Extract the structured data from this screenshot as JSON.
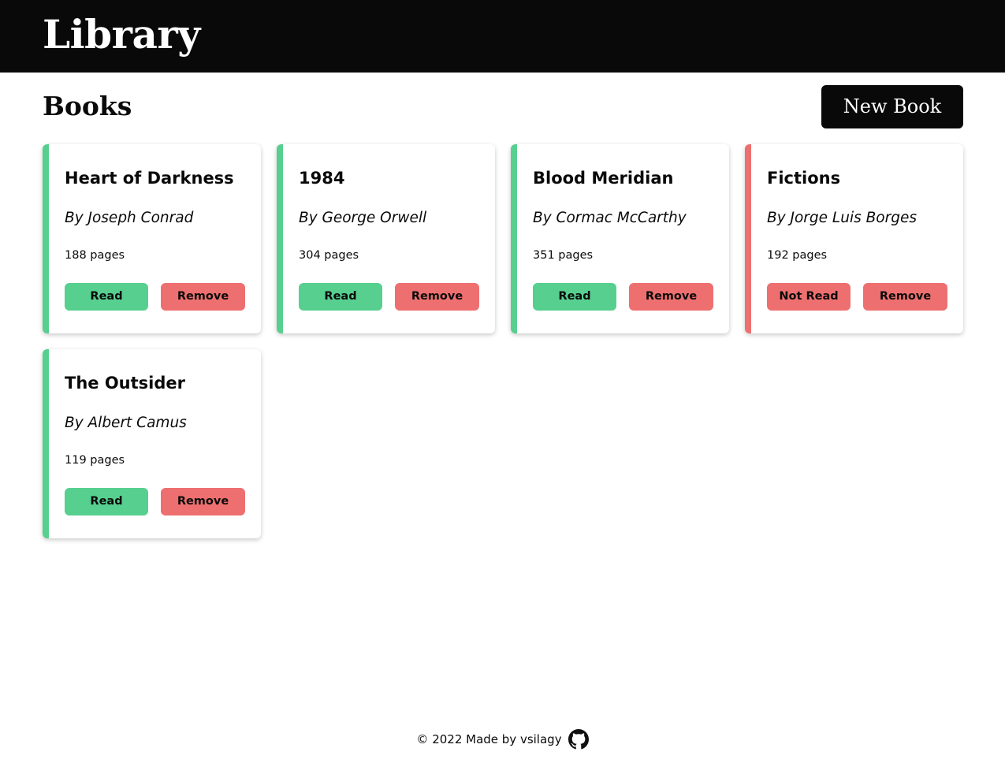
{
  "header": {
    "title": "Library"
  },
  "main": {
    "section_title": "Books",
    "new_book_label": "New Book"
  },
  "books": [
    {
      "title": "Heart of Darkness",
      "author": "By Joseph Conrad",
      "pages": "188 pages",
      "status_label": "Read",
      "read": true,
      "remove_label": "Remove"
    },
    {
      "title": "1984",
      "author": "By George Orwell",
      "pages": "304 pages",
      "status_label": "Read",
      "read": true,
      "remove_label": "Remove"
    },
    {
      "title": "Blood Meridian",
      "author": "By Cormac McCarthy",
      "pages": "351 pages",
      "status_label": "Read",
      "read": true,
      "remove_label": "Remove"
    },
    {
      "title": "Fictions",
      "author": "By Jorge Luis Borges",
      "pages": "192 pages",
      "status_label": "Not Read",
      "read": false,
      "remove_label": "Remove"
    },
    {
      "title": "The Outsider",
      "author": "By Albert Camus",
      "pages": "119 pages",
      "status_label": "Read",
      "read": true,
      "remove_label": "Remove"
    }
  ],
  "footer": {
    "text": "© 2022 Made by vsilagy",
    "icon": "github-icon"
  },
  "colors": {
    "header_bg": "#090909",
    "read_accent": "#57cf8f",
    "not_read_accent": "#ee6f6f",
    "button_dark": "#090909"
  }
}
